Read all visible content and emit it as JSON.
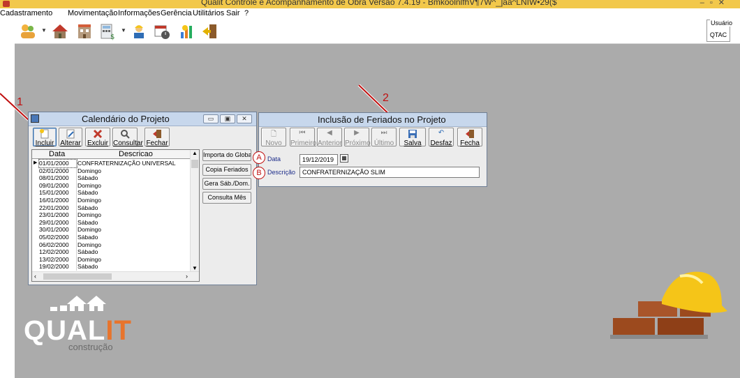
{
  "app": {
    "title": "Qualit Controle e Acompanhamento de Obra Versão 7.4.19 - BmkoolnlfhV¶7W^_]aa^LNIW•29($"
  },
  "menu": [
    "Cadastramento",
    "Movimentação",
    "Informações",
    "Gerência",
    "Utilitários",
    "Sair",
    "?"
  ],
  "toolbar": {
    "icons": [
      "people-icon",
      "house-icon",
      "building-icon",
      "calculator-icon",
      "worker-icon",
      "calendar-clock-icon",
      "chart-icon",
      "exit-icon"
    ]
  },
  "user": {
    "label": "Usuário",
    "value": "QTAC"
  },
  "calendar_window": {
    "title": "Calendário do Projeto",
    "buttons": {
      "incluir": "Incluir",
      "alterar": "Alterar",
      "excluir": "Excluir",
      "consultar": "Consultar",
      "fechar": "Fechar"
    },
    "side_buttons": {
      "importa": "Importa do Global",
      "copia": "Copia Feriados",
      "gera": "Gera Sáb./Dom.",
      "consulta": "Consulta Mês"
    },
    "columns": {
      "data": "Data",
      "descricao": "Descricao"
    },
    "rows": [
      {
        "date": "01/01/2000",
        "desc": "CONFRATERNIZAÇÃO UNIVERSAL"
      },
      {
        "date": "02/01/2000",
        "desc": "Domingo"
      },
      {
        "date": "08/01/2000",
        "desc": "Sábado"
      },
      {
        "date": "09/01/2000",
        "desc": "Domingo"
      },
      {
        "date": "15/01/2000",
        "desc": "Sábado"
      },
      {
        "date": "16/01/2000",
        "desc": "Domingo"
      },
      {
        "date": "22/01/2000",
        "desc": "Sábado"
      },
      {
        "date": "23/01/2000",
        "desc": "Domingo"
      },
      {
        "date": "29/01/2000",
        "desc": "Sábado"
      },
      {
        "date": "30/01/2000",
        "desc": "Domingo"
      },
      {
        "date": "05/02/2000",
        "desc": "Sábado"
      },
      {
        "date": "06/02/2000",
        "desc": "Domingo"
      },
      {
        "date": "12/02/2000",
        "desc": "Sábado"
      },
      {
        "date": "13/02/2000",
        "desc": "Domingo"
      },
      {
        "date": "19/02/2000",
        "desc": "Sábado"
      }
    ]
  },
  "holiday_window": {
    "title": "Inclusão de Feriados no Projeto",
    "buttons": {
      "novo": "Novo",
      "primeiro": "Primeiro",
      "anterior": "Anterior",
      "proximo": "Próximo",
      "ultimo": "Último",
      "salva": "Salva",
      "desfaz": "Desfaz",
      "fecha": "Fecha"
    },
    "fields": {
      "data_label": "Data",
      "data_value": "19/12/2019",
      "descricao_label": "Descrição",
      "descricao_value": "CONFRATERNIZAÇÃO SLIM"
    }
  },
  "annotations": {
    "step1": "1",
    "step2": "2",
    "callout_a": "A",
    "callout_b": "B"
  },
  "branding": {
    "logo_main": "QUAL",
    "logo_it": "IT",
    "logo_sub": "construção"
  },
  "colors": {
    "accent_red": "#c01010",
    "logo_orange": "#e8742c",
    "helmet_yellow": "#f5c518",
    "brick": "#9c4a1e"
  }
}
